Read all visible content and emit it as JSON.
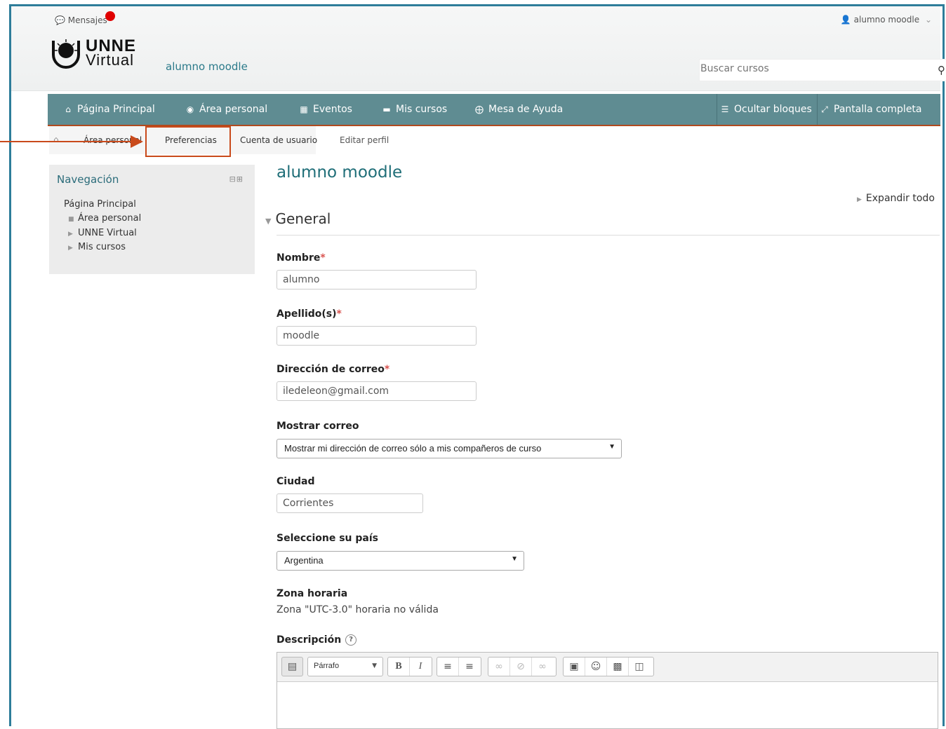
{
  "header": {
    "messages_label": "Mensajes",
    "user_menu_label": "alumno moodle",
    "logo_line1": "UNNE",
    "logo_line2": "Virtual",
    "site_user_name": "alumno moodle",
    "search_placeholder": "Buscar cursos"
  },
  "navbar": {
    "items": [
      {
        "label": "Página Principal",
        "icon": "home-icon"
      },
      {
        "label": "Área personal",
        "icon": "dashboard-icon"
      },
      {
        "label": "Eventos",
        "icon": "calendar-icon"
      },
      {
        "label": "Mis cursos",
        "icon": "briefcase-icon"
      },
      {
        "label": "Mesa de Ayuda",
        "icon": "lifebuoy-icon"
      }
    ],
    "hide_blocks_label": "Ocultar bloques",
    "fullscreen_label": "Pantalla completa"
  },
  "breadcrumb": [
    "Área personal",
    "Preferencias",
    "Cuenta de usuario",
    "Editar perfil"
  ],
  "sidebar": {
    "title": "Navegación",
    "items": [
      "Página Principal",
      "Área personal",
      "UNNE Virtual",
      "Mis cursos"
    ]
  },
  "page": {
    "title": "alumno moodle",
    "expand_all": "Expandir todo",
    "section_title": "General"
  },
  "form": {
    "nombre_label": "Nombre",
    "nombre_value": "alumno",
    "apellido_label": "Apellido(s)",
    "apellido_value": "moodle",
    "email_label": "Dirección de correo",
    "email_value": "iledeleon@gmail.com",
    "show_email_label": "Mostrar correo",
    "show_email_value": "Mostrar mi dirección de correo sólo a mis compañeros de curso",
    "city_label": "Ciudad",
    "city_value": "Corrientes",
    "country_label": "Seleccione su país",
    "country_value": "Argentina",
    "timezone_label": "Zona horaria",
    "timezone_value": "Zona \"UTC-3.0\" horaria no válida",
    "description_label": "Descripción",
    "required_mark": "*"
  },
  "editor": {
    "paragraph_format": "Párrafo"
  },
  "colors": {
    "navbar": "#5f8c92",
    "accent": "#1f6e78",
    "annotation": "#c94a1b"
  }
}
